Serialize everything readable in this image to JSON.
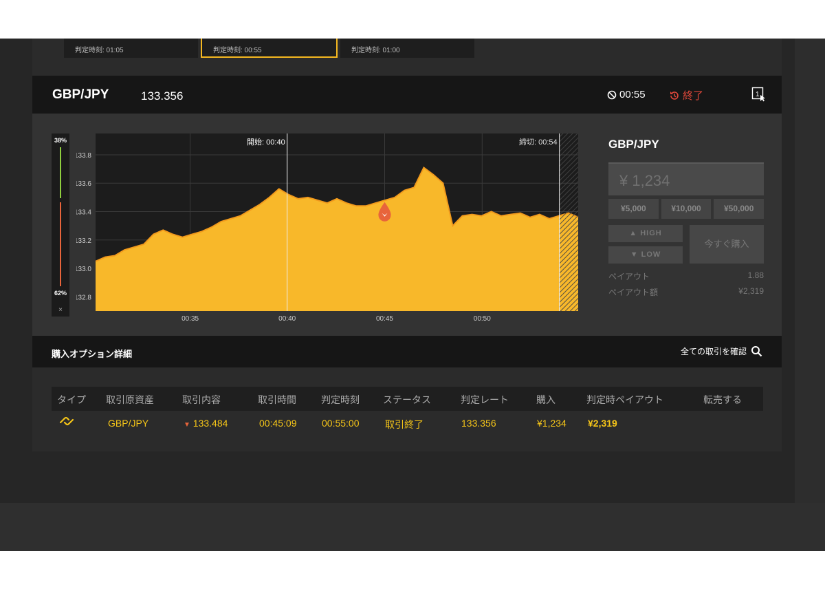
{
  "strip": {
    "cards": [
      {
        "label": "判定時刻: 01:05"
      },
      {
        "label": "判定時刻: 00:55"
      },
      {
        "label": "判定時刻: 01:00"
      }
    ]
  },
  "header": {
    "pair": "GBP/JPY",
    "price": "133.356",
    "timer": "00:55",
    "status": "終了"
  },
  "sentiment": {
    "high_pct": "38%",
    "low_pct": "62%",
    "high_value": 0.38,
    "low_value": 0.62,
    "close": "×"
  },
  "chart": {
    "start_label": "開始: 00:40",
    "deadline_label": "締切: 00:54",
    "y_ticks": [
      "133.8",
      "133.6",
      "133.4",
      "133.2",
      "133.0",
      "132.8"
    ],
    "x_ticks": [
      "00:35",
      "00:40",
      "00:45",
      "00:50"
    ],
    "colors": {
      "fill": "#f8b82a",
      "bg": "#1c1c1c",
      "grid": "#3a3a3a"
    }
  },
  "chart_data": {
    "type": "area",
    "ylim": [
      132.7,
      133.95
    ],
    "x_ticks": [
      "00:35",
      "00:40",
      "00:45",
      "00:50"
    ],
    "y_ticks": [
      133.8,
      133.6,
      133.4,
      133.2,
      133.0,
      132.8
    ],
    "start": "00:40",
    "deadline": "00:54",
    "series": [
      {
        "x": [
          0,
          2,
          4,
          6,
          8,
          10,
          12,
          14,
          16,
          18,
          20,
          22,
          24,
          26,
          28,
          30,
          32,
          34,
          36,
          38,
          40,
          42,
          44,
          46,
          48,
          50,
          52,
          54,
          56,
          58,
          60,
          62,
          64,
          66,
          68,
          70,
          72,
          74,
          76,
          78,
          80,
          82,
          84,
          86,
          88,
          90,
          92,
          94,
          96,
          98,
          100
        ],
        "values": [
          133.05,
          133.08,
          133.09,
          133.13,
          133.15,
          133.17,
          133.24,
          133.27,
          133.24,
          133.22,
          133.24,
          133.26,
          133.29,
          133.33,
          133.35,
          133.37,
          133.41,
          133.45,
          133.5,
          133.56,
          133.52,
          133.49,
          133.5,
          133.48,
          133.46,
          133.49,
          133.46,
          133.44,
          133.44,
          133.46,
          133.48,
          133.5,
          133.55,
          133.57,
          133.71,
          133.66,
          133.6,
          133.3,
          133.37,
          133.38,
          133.37,
          133.4,
          133.37,
          133.38,
          133.39,
          133.36,
          133.38,
          133.35,
          133.37,
          133.39,
          133.36
        ]
      }
    ]
  },
  "panel": {
    "title": "GBP/JPY",
    "amount": "¥ 1,234",
    "quick": [
      "¥5,000",
      "¥10,000",
      "¥50,000"
    ],
    "high": "HIGH",
    "low": "LOW",
    "buy_now": "今すぐ購入",
    "payout_label": "ペイアウト",
    "payout_value": "1.88",
    "payout_amount_label": "ペイアウト額",
    "payout_amount_value": "¥2,319"
  },
  "details": {
    "title": "購入オプション詳細",
    "link": "全ての取引を確認"
  },
  "table": {
    "headers": [
      "タイプ",
      "取引原資産",
      "取引内容",
      "取引時間",
      "判定時刻",
      "ステータス",
      "判定レート",
      "購入",
      "判定時ペイアウト",
      "転売する"
    ],
    "row": {
      "asset": "GBP/JPY",
      "content": "133.484",
      "trade_time": "00:45:09",
      "judge_time": "00:55:00",
      "status": "取引終了",
      "rate": "133.356",
      "purchase": "¥1,234",
      "payout": "¥2,319"
    }
  }
}
